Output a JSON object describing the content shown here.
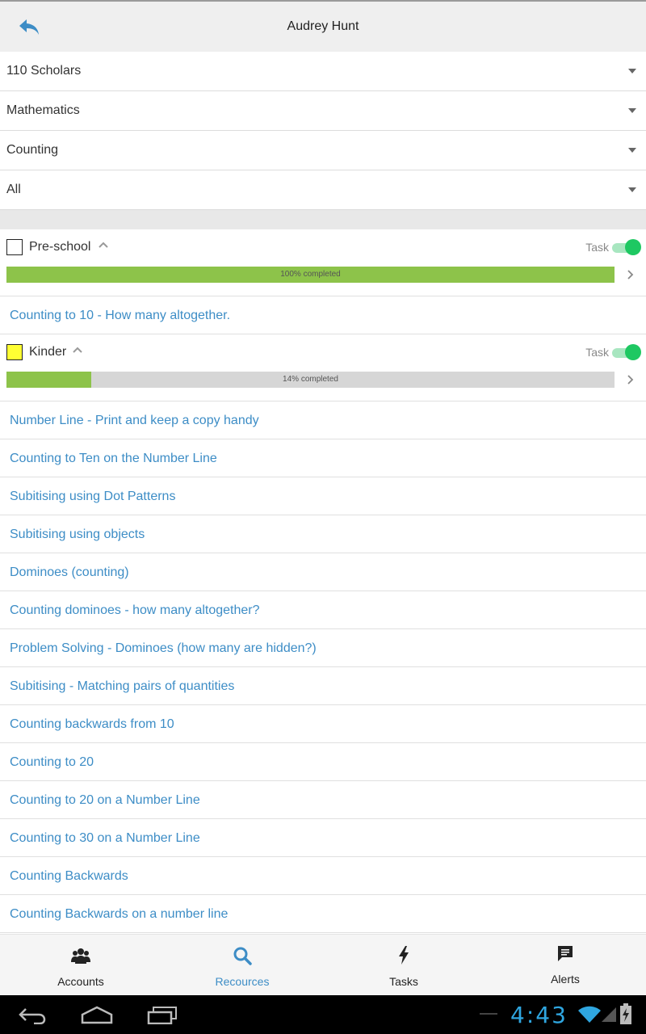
{
  "header": {
    "title": "Audrey Hunt",
    "back_icon": "reply-arrow-icon"
  },
  "filters": [
    {
      "value": "110 Scholars"
    },
    {
      "value": "Mathematics"
    },
    {
      "value": "Counting"
    },
    {
      "value": "All"
    }
  ],
  "groups": [
    {
      "name": "Pre-school",
      "checkbox_color": "#ffffff",
      "task_label": "Task",
      "task_enabled": true,
      "progress_text": "100% completed",
      "progress_fraction": 1.0
    },
    {
      "name": "Kinder",
      "checkbox_color": "#ffff33",
      "task_label": "Task",
      "task_enabled": true,
      "progress_text": "14% completed",
      "progress_fraction": 0.14
    }
  ],
  "preschool_resources": [
    "Counting to 10 - How many altogether."
  ],
  "kinder_resources": [
    "Number Line - Print and keep a copy handy",
    "Counting to Ten on the Number Line",
    "Subitising using Dot Patterns",
    "Subitising using objects",
    "Dominoes (counting)",
    "Counting dominoes - how many altogether?",
    "Problem Solving - Dominoes (how many are hidden?)",
    "Subitising - Matching pairs of quantities",
    "Counting backwards from 10",
    "Counting to 20",
    "Counting to 20 on a Number Line",
    "Counting to 30 on a Number Line",
    "Counting Backwards",
    "Counting Backwards on a number line"
  ],
  "bottom_nav": [
    {
      "label": "Accounts",
      "icon": "users-icon",
      "active": false
    },
    {
      "label": "Recources",
      "icon": "search-icon",
      "active": true
    },
    {
      "label": "Tasks",
      "icon": "lightning-icon",
      "active": false
    },
    {
      "label": "Alerts",
      "icon": "chat-bubble-icon",
      "active": false
    }
  ],
  "status_bar": {
    "time": "4:43"
  },
  "colors": {
    "accent": "#3d8dc6",
    "progress_green": "#8dc34a",
    "toggle_green": "#1ec862"
  }
}
